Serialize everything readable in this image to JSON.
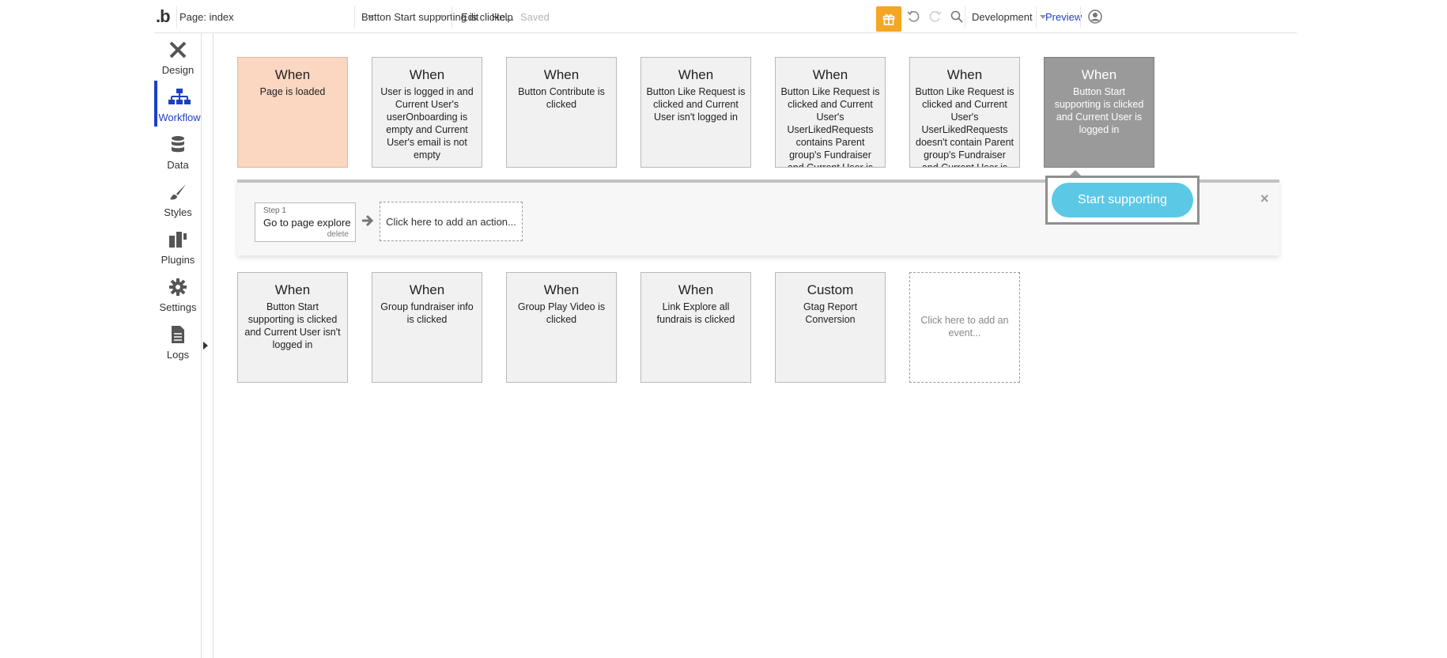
{
  "topbar": {
    "logo": ".b",
    "page_selector": "Page: index",
    "event_selector": "Button Start supporting is clicke...",
    "menu_edit": "Edit",
    "menu_help": "Help",
    "save_status": "Saved",
    "environment": "Development",
    "preview": "Preview",
    "gift_color": "#f5a623"
  },
  "sidebar": {
    "items": [
      {
        "label": "Design",
        "icon": "design-icon"
      },
      {
        "label": "Workflow",
        "icon": "workflow-icon",
        "active": true
      },
      {
        "label": "Data",
        "icon": "database-icon"
      },
      {
        "label": "Styles",
        "icon": "brush-icon"
      },
      {
        "label": "Plugins",
        "icon": "plugin-icon"
      },
      {
        "label": "Settings",
        "icon": "gear-icon"
      },
      {
        "label": "Logs",
        "icon": "document-icon"
      }
    ],
    "accent_color": "#1e3fc5"
  },
  "events_row1": [
    {
      "kw": "When",
      "desc": "Page is loaded"
    },
    {
      "kw": "When",
      "desc": "User is logged in and Current User's userOnboarding is empty and Current User's email is not empty"
    },
    {
      "kw": "When",
      "desc": "Button Contribute is clicked"
    },
    {
      "kw": "When",
      "desc": "Button Like Request is clicked and Current User isn't logged in"
    },
    {
      "kw": "When",
      "desc": "Button Like Request is clicked and Current User's UserLikedRequests contains Parent group's Fundraiser and Current User is"
    },
    {
      "kw": "When",
      "desc": "Button Like Request is clicked and Current User's UserLikedRequests doesn't contain Parent group's Fundraiser and Current User is"
    },
    {
      "kw": "When",
      "desc": "Button Start supporting is clicked and Current User is logged in"
    }
  ],
  "events_row2": [
    {
      "kw": "When",
      "desc": "Button Start supporting is clicked and Current User isn't logged in"
    },
    {
      "kw": "When",
      "desc": "Group fundraiser info is clicked"
    },
    {
      "kw": "When",
      "desc": "Group Play Video is clicked"
    },
    {
      "kw": "When",
      "desc": "Link Explore all fundrais is clicked"
    },
    {
      "kw": "Custom",
      "desc": "Gtag Report Conversion"
    },
    {
      "kw": "",
      "desc": "Click here to add an event..."
    }
  ],
  "actions": {
    "step1_label": "Step 1",
    "step1_name": "Go to page explore",
    "step1_delete": "delete",
    "add_action": "Click here to add an action...",
    "close": "×"
  },
  "element_preview": {
    "button_label": "Start supporting",
    "button_color": "#5bc8e6"
  }
}
